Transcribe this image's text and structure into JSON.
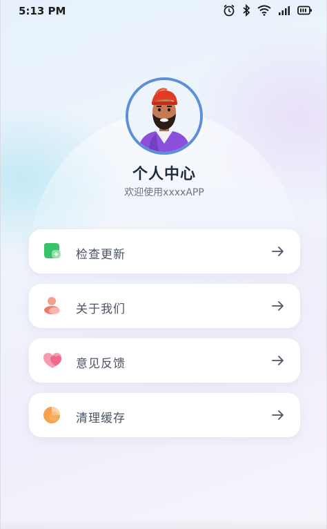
{
  "status_bar": {
    "time": "5:13 PM",
    "icons": [
      "alarm-icon",
      "bluetooth-icon",
      "wifi-icon",
      "signal-icon",
      "battery-icon"
    ]
  },
  "profile": {
    "title": "个人中心",
    "subtitle": "欢迎使用xxxxAPP",
    "avatar_border_color": "#5d8fd8"
  },
  "menu": {
    "items": [
      {
        "label": "检查更新",
        "icon": "update-icon",
        "color": "#3cc26a"
      },
      {
        "label": "关于我们",
        "icon": "about-icon",
        "color": "#f28c7a"
      },
      {
        "label": "意见反馈",
        "icon": "feedback-icon",
        "color": "#f2708f"
      },
      {
        "label": "清理缓存",
        "icon": "clear-cache-icon",
        "color": "#f2a04a"
      }
    ]
  }
}
